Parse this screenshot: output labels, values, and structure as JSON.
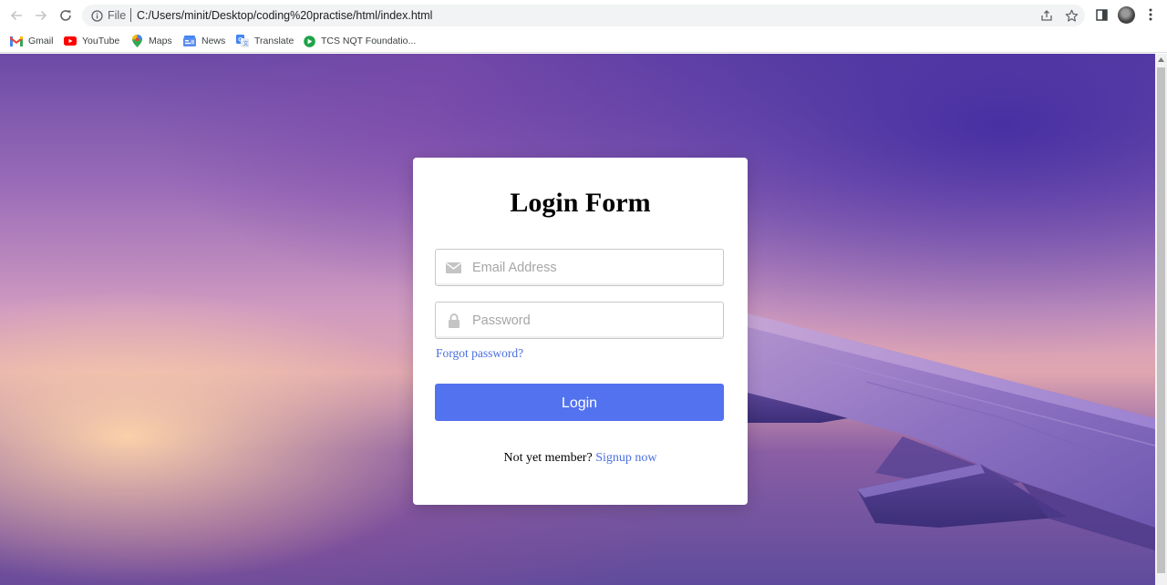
{
  "browser": {
    "url_scheme": "File",
    "url": "C:/Users/minit/Desktop/coding%20practise/html/index.html",
    "bookmarks": [
      {
        "label": "Gmail",
        "icon": "gmail-icon"
      },
      {
        "label": "YouTube",
        "icon": "youtube-icon"
      },
      {
        "label": "Maps",
        "icon": "maps-icon"
      },
      {
        "label": "News",
        "icon": "news-icon"
      },
      {
        "label": "Translate",
        "icon": "translate-icon"
      },
      {
        "label": "TCS NQT Foundatio...",
        "icon": "tcs-icon"
      }
    ]
  },
  "login": {
    "title": "Login Form",
    "email_placeholder": "Email Address",
    "password_placeholder": "Password",
    "forgot_label": "Forgot password?",
    "login_label": "Login",
    "signup_prompt": "Not yet member?",
    "signup_link": "Signup now"
  },
  "colors": {
    "accent": "#5372f0",
    "link": "#4a6fe0"
  }
}
